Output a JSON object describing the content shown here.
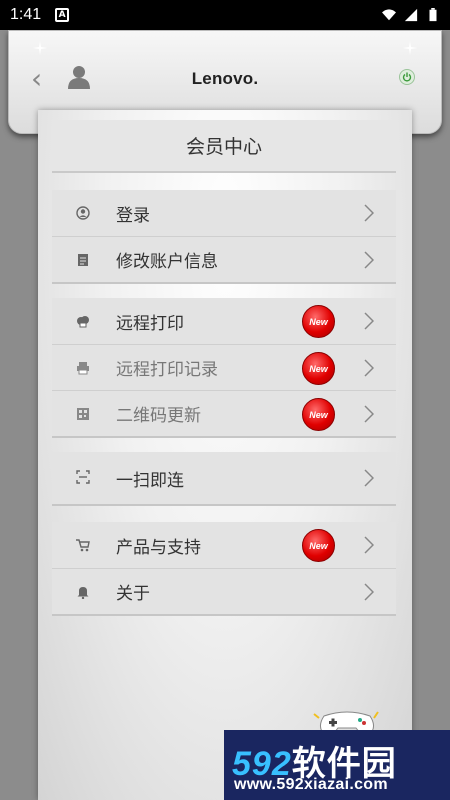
{
  "status_bar": {
    "time": "1:41",
    "notification_letter": "A"
  },
  "header": {
    "brand": "Lenovo."
  },
  "page_title": "会员中心",
  "groups": [
    {
      "items": [
        {
          "label": "登录",
          "icon": "user-circle-icon",
          "dim": false,
          "new": false
        },
        {
          "label": "修改账户信息",
          "icon": "edit-doc-icon",
          "dim": false,
          "new": false
        }
      ]
    },
    {
      "items": [
        {
          "label": "远程打印",
          "icon": "cloud-print-icon",
          "dim": false,
          "new": true
        },
        {
          "label": "远程打印记录",
          "icon": "printer-icon",
          "dim": true,
          "new": true
        },
        {
          "label": "二维码更新",
          "icon": "qr-code-icon",
          "dim": true,
          "new": true
        }
      ]
    },
    {
      "items": [
        {
          "label": "一扫即连",
          "icon": "scan-icon",
          "dim": false,
          "new": false
        }
      ]
    },
    {
      "items": [
        {
          "label": "产品与支持",
          "icon": "cart-icon",
          "dim": false,
          "new": true
        },
        {
          "label": "关于",
          "icon": "bell-icon",
          "dim": false,
          "new": false
        }
      ]
    }
  ],
  "badge_text": "New",
  "watermark": {
    "logo_num": "592",
    "logo_text": "软件园",
    "url": "www.592xiazai.com"
  },
  "colors": {
    "badge": "#e00000",
    "sheet": "#f1f1f1",
    "row": "#e3e3e3",
    "watermark_bg": "#1a2660"
  }
}
